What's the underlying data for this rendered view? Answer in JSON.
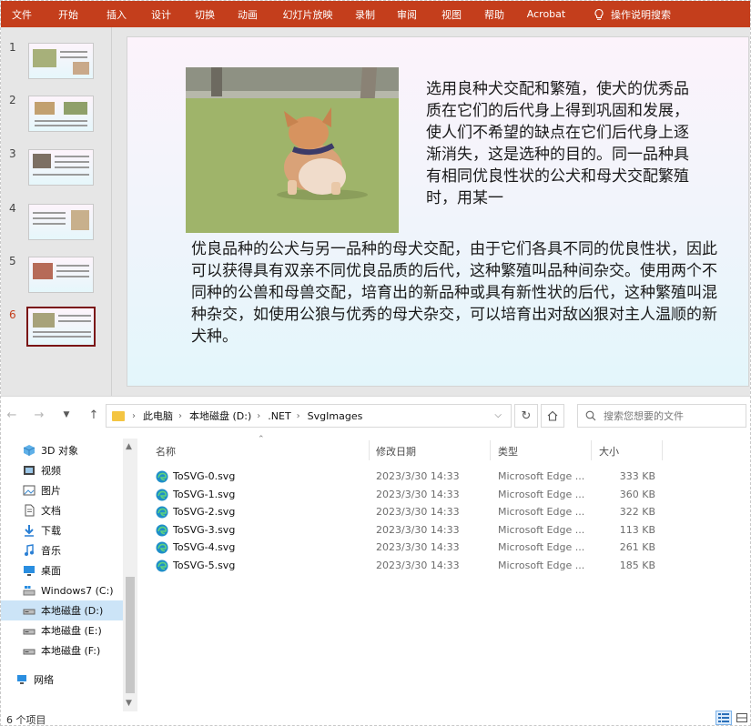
{
  "ribbon": {
    "tabs": [
      "文件",
      "开始",
      "插入",
      "设计",
      "切换",
      "动画",
      "幻灯片放映",
      "录制",
      "审阅",
      "视图",
      "帮助",
      "Acrobat"
    ],
    "tell_me": "操作说明搜索",
    "bg_color": "#c43e1c"
  },
  "slides": {
    "numbers": [
      "1",
      "2",
      "3",
      "4",
      "5",
      "6"
    ],
    "active_index": 6
  },
  "slide": {
    "text_top": "选用良种犬交配和繁殖，使犬的优秀品质在它们的后代身上得到巩固和发展，使人们不希望的缺点在它们后代身上逐渐消失，这是选种的目的。同一品种具有相同优良性状的公犬和母犬交配繁殖时，用某一",
    "text_bottom": "优良品种的公犬与另一品种的母犬交配，由于它们各具不同的优良性状，因此可以获得具有双亲不同优良品质的后代，这种繁殖叫品种间杂交。使用两个不同种的公兽和母兽交配，培育出的新品种或具有新性状的后代，这种繁殖叫混种杂交，如使用公狼与优秀的母犬杂交，可以培育出对敌凶狠对主人温顺的新犬种。"
  },
  "explorer": {
    "breadcrumb": [
      "此电脑",
      "本地磁盘 (D:)",
      ".NET",
      "SvgImages"
    ],
    "search_placeholder": "搜索您想要的文件",
    "nav": [
      {
        "label": "3D 对象",
        "icon": "cube-icon"
      },
      {
        "label": "视频",
        "icon": "video-icon"
      },
      {
        "label": "图片",
        "icon": "picture-icon"
      },
      {
        "label": "文档",
        "icon": "document-icon"
      },
      {
        "label": "下载",
        "icon": "download-icon"
      },
      {
        "label": "音乐",
        "icon": "music-icon"
      },
      {
        "label": "桌面",
        "icon": "desktop-icon"
      },
      {
        "label": "Windows7 (C:)",
        "icon": "windows-drive-icon"
      },
      {
        "label": "本地磁盘 (D:)",
        "icon": "drive-icon",
        "selected": true
      },
      {
        "label": "本地磁盘 (E:)",
        "icon": "drive-icon"
      },
      {
        "label": "本地磁盘 (F:)",
        "icon": "drive-icon"
      },
      {
        "label": "网络",
        "icon": "network-icon"
      }
    ],
    "columns": {
      "name": "名称",
      "date": "修改日期",
      "type": "类型",
      "size": "大小"
    },
    "files": [
      {
        "name": "ToSVG-0.svg",
        "date": "2023/3/30 14:33",
        "type": "Microsoft Edge ...",
        "size": "333 KB"
      },
      {
        "name": "ToSVG-1.svg",
        "date": "2023/3/30 14:33",
        "type": "Microsoft Edge ...",
        "size": "360 KB"
      },
      {
        "name": "ToSVG-2.svg",
        "date": "2023/3/30 14:33",
        "type": "Microsoft Edge ...",
        "size": "322 KB"
      },
      {
        "name": "ToSVG-3.svg",
        "date": "2023/3/30 14:33",
        "type": "Microsoft Edge ...",
        "size": "113 KB"
      },
      {
        "name": "ToSVG-4.svg",
        "date": "2023/3/30 14:33",
        "type": "Microsoft Edge ...",
        "size": "261 KB"
      },
      {
        "name": "ToSVG-5.svg",
        "date": "2023/3/30 14:33",
        "type": "Microsoft Edge ...",
        "size": "185 KB"
      }
    ],
    "status": "6 个项目"
  }
}
